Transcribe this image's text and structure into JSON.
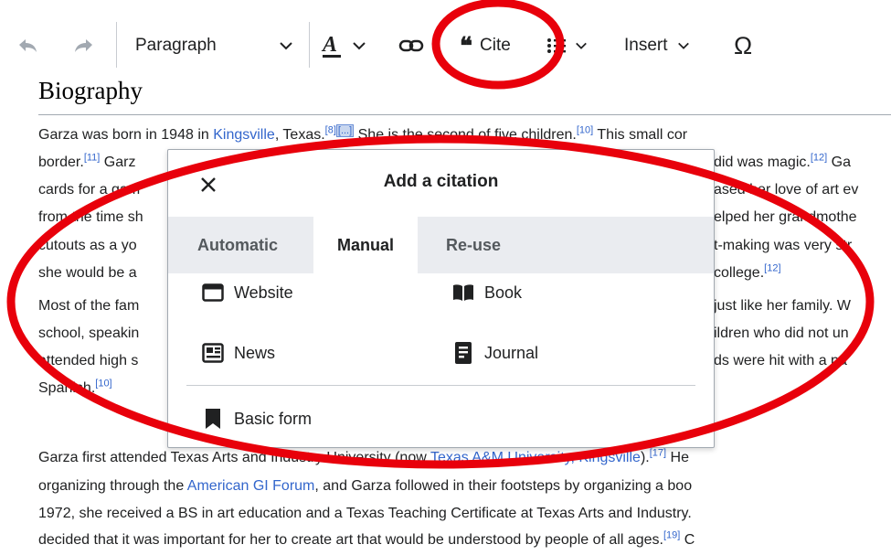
{
  "toolbar": {
    "format_label": "Paragraph",
    "cite_label": "Cite",
    "insert_label": "Insert"
  },
  "section": {
    "heading": "Biography"
  },
  "paragraphs": {
    "l1": {
      "a": "Garza was born in 1948 in ",
      "link": "Kingsville",
      "b": ", Texas.",
      "ref1": "[8]",
      "ref2": "[...]",
      "c": " She is the second of five children.",
      "ref3": "[10]",
      "d": " This small cor"
    },
    "l2": {
      "a": "border.",
      "ref1": "[11]",
      "b": " Garz",
      "c": "did was magic.",
      "ref2": "[12]",
      "d": " Ga"
    },
    "l3": {
      "a": "cards for a gam",
      "b": "ased her love of art ev"
    },
    "l4": {
      "a": "from the time sh",
      "b": "elped her grandmothe"
    },
    "l5": {
      "a": "cutouts as a yo",
      "b": "t-making was very str"
    },
    "l6": {
      "a": "she would be a",
      "b": " college.",
      "ref": "[12]"
    },
    "l7": {
      "a": "Most of the fam",
      "b": "just like her family. W"
    },
    "l8": {
      "a": "school, speakin",
      "b": "ildren who did not un"
    },
    "l9": {
      "a": "attended high s",
      "b": "ds were hit with a pa"
    },
    "l10": {
      "a": "Spanish.",
      "ref": "[10]"
    },
    "l11": {
      "a": "Garza first attended Texas Arts and Industry University (now ",
      "link": "Texas A&M University, Kingsville",
      "b": ").",
      "ref": "[17]",
      "c": " He"
    },
    "l12": {
      "a": "organizing through the ",
      "link": "American GI Forum",
      "b": ", and Garza followed in their footsteps by organizing a boo"
    },
    "l13": {
      "a": "1972, she received a BS in art education and a Texas Teaching Certificate at Texas Arts and Industry."
    },
    "l14": {
      "a": "decided that it was important for her to create art that would be understood by people of all ages.",
      "ref": "[19]",
      "b": " C"
    }
  },
  "dialog": {
    "title": "Add a citation",
    "tabs": [
      "Automatic",
      "Manual",
      "Re-use"
    ],
    "active_tab": "Manual",
    "options": {
      "website": "Website",
      "book": "Book",
      "news": "News",
      "journal": "Journal",
      "basic": "Basic form"
    }
  },
  "colors": {
    "link": "#3366cc",
    "annotation": "#e8000b",
    "tabbar": "#eaecf0"
  }
}
